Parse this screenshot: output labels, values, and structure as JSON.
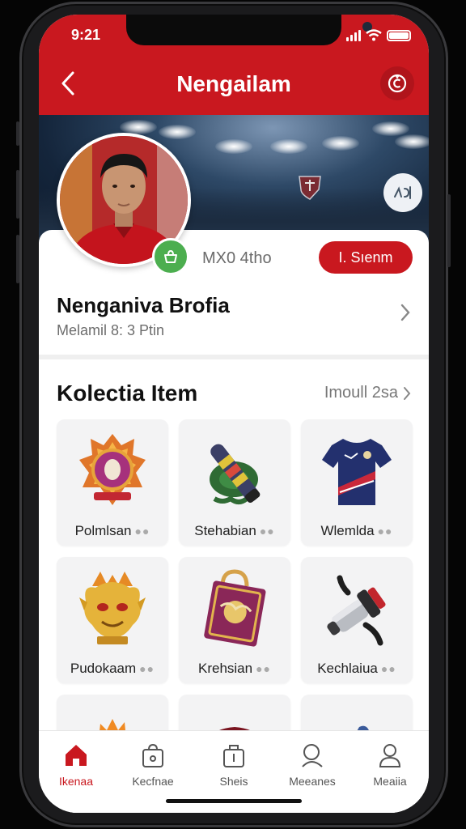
{
  "status_bar": {
    "time": "9:21"
  },
  "header": {
    "title": "Nengailam"
  },
  "profile": {
    "stat": "MX0 4tho",
    "action_label": "I. Sıenm",
    "name": "Nenganiva Brofia",
    "subtitle": "Melamil 8: 3 Ptin"
  },
  "collection": {
    "title": "Kolectia Item",
    "see_all": "Imoull 2sa",
    "items": [
      {
        "label": "Polmlsan",
        "icon": "crest-emblem-icon"
      },
      {
        "label": "Stehabian",
        "icon": "scarf-icon"
      },
      {
        "label": "Wlemlda",
        "icon": "jersey-icon"
      },
      {
        "label": "Pudokaam",
        "icon": "golden-mascot-icon"
      },
      {
        "label": "Krehsian",
        "icon": "tote-bag-icon"
      },
      {
        "label": "Kechlaiua",
        "icon": "horn-icon"
      }
    ]
  },
  "bottom_nav": [
    {
      "label": "Ikenaa",
      "icon": "home-icon",
      "active": true
    },
    {
      "label": "Kecfnae",
      "icon": "bag-icon",
      "active": false
    },
    {
      "label": "Sheis",
      "icon": "store-icon",
      "active": false
    },
    {
      "label": "Meeanes",
      "icon": "search-icon",
      "active": false
    },
    {
      "label": "Meaiia",
      "icon": "profile-icon",
      "active": false
    }
  ],
  "colors": {
    "accent": "#c9181f",
    "verified": "#4cae4f"
  }
}
